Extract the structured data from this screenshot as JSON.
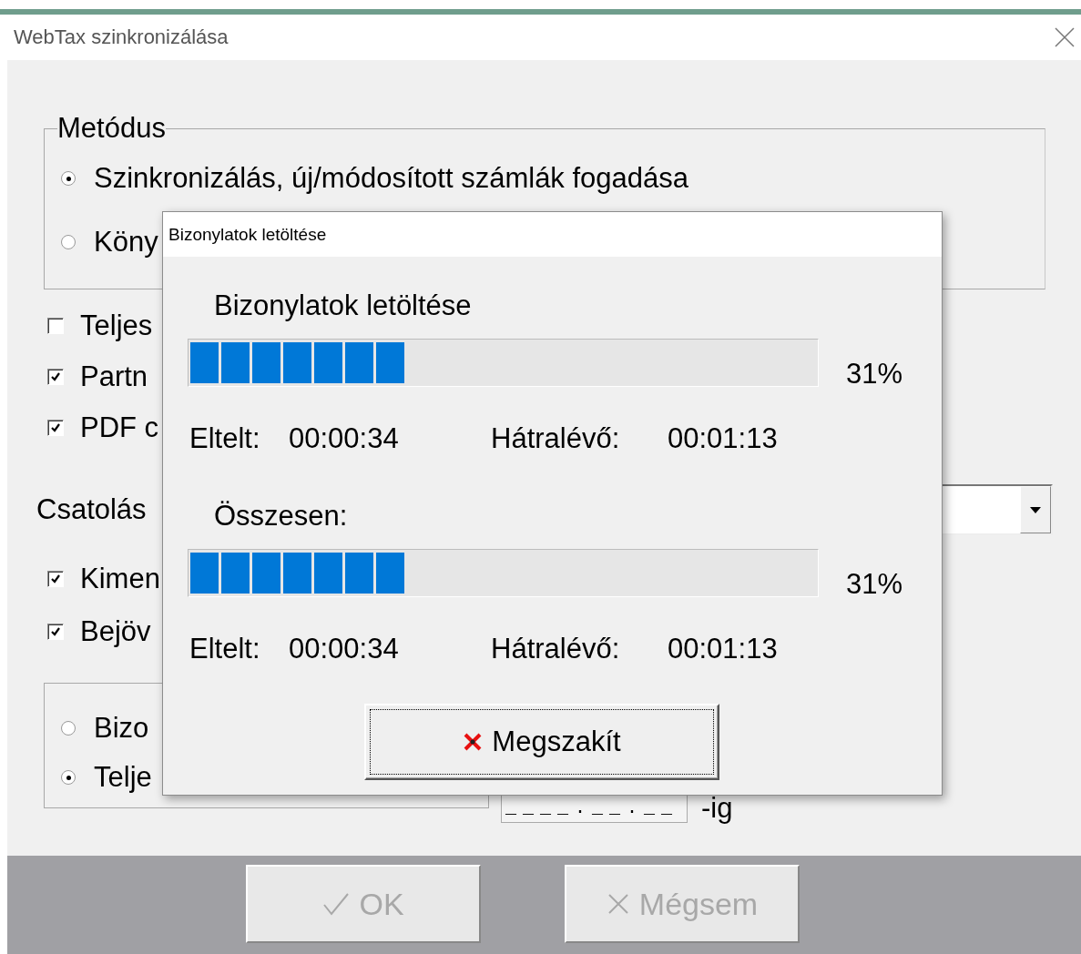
{
  "window": {
    "title": "WebTax szinkronizálása"
  },
  "method_group": {
    "legend": "Metódus",
    "options": [
      {
        "label": "Szinkronizálás, új/módosított számlák fogadása",
        "selected": true
      },
      {
        "label": "Köny",
        "selected": false
      }
    ]
  },
  "checkboxes": [
    {
      "label": "Teljes",
      "checked": false
    },
    {
      "label": "Partn",
      "checked": true
    },
    {
      "label": "PDF c",
      "checked": true
    }
  ],
  "attachment": {
    "label": "Csatolás"
  },
  "attachment_checkboxes": [
    {
      "label": "Kimen",
      "checked": true
    },
    {
      "label": "Bejöv",
      "checked": true
    }
  ],
  "date_group": {
    "options": [
      {
        "label": "Bizo",
        "selected": false
      },
      {
        "label": "Telje",
        "selected": true
      }
    ]
  },
  "date_field": {
    "value": "____.__.__",
    "suffix": "-ig"
  },
  "buttons": [
    {
      "kind": "ok",
      "label": "OK",
      "disabled": true
    },
    {
      "kind": "cancel",
      "label": "Mégsem",
      "disabled": true
    }
  ],
  "dialog": {
    "title": "Bizonylatok letöltése",
    "sections": [
      {
        "heading": "Bizonylatok letöltése",
        "level": 0.31,
        "percent": "31%",
        "elapsed_label": "Eltelt:",
        "elapsed": "00:00:34",
        "remaining_label": "Hátralévő:",
        "remaining": "00:01:13"
      },
      {
        "heading": "Összesen:",
        "level": 0.31,
        "percent": "31%",
        "elapsed_label": "Eltelt:",
        "elapsed": "00:00:34",
        "remaining_label": "Hátralévő:",
        "remaining": "00:01:13"
      }
    ],
    "button": {
      "label": "Megszakít",
      "focused": true
    }
  }
}
